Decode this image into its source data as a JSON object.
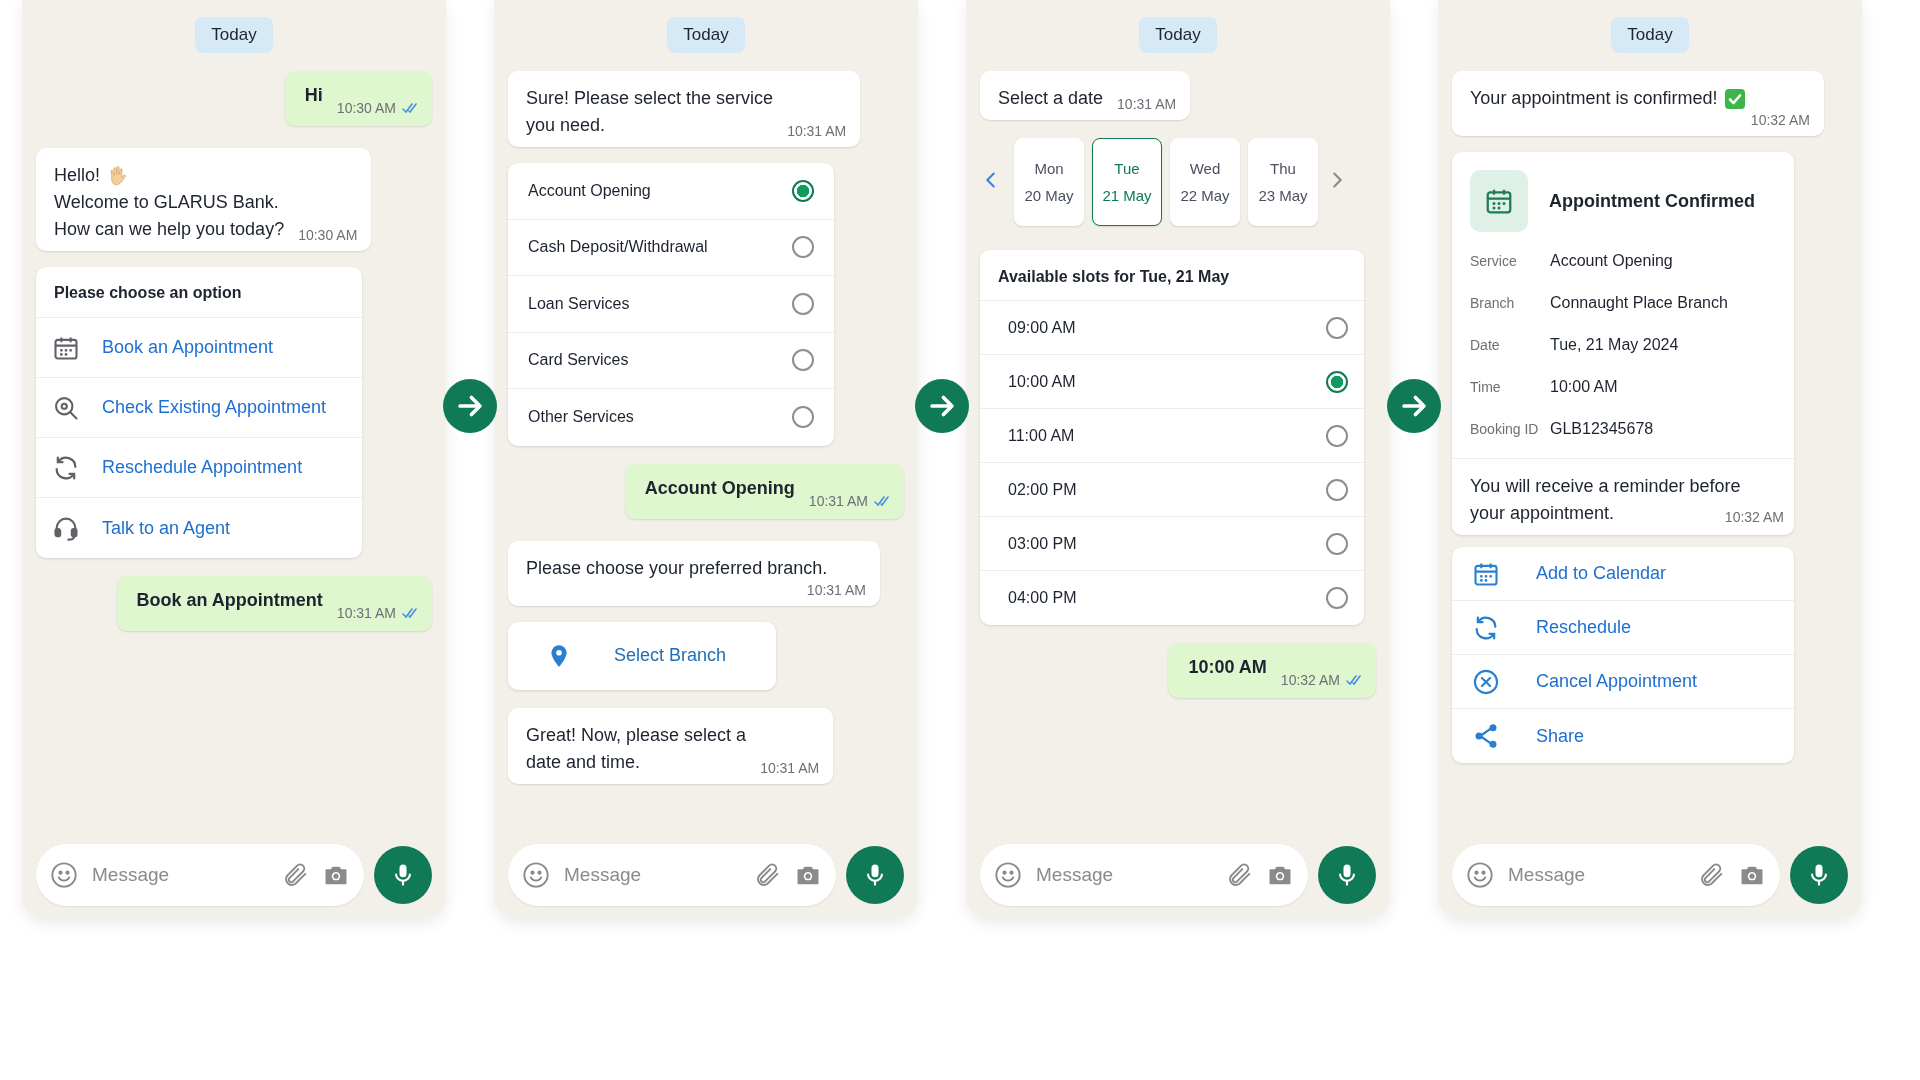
{
  "panels": [
    {
      "date_chip": "Today",
      "messages": [
        {
          "kind": "outgoing",
          "text": "Hi",
          "time": "10:30 AM",
          "read": true
        },
        {
          "kind": "greeting",
          "lines": [
            "Hello!",
            "Welcome to GLARUS Bank.",
            "How can we help you today?"
          ],
          "time": "10:30 AM"
        },
        {
          "kind": "menu",
          "title": "Please choose an option",
          "items": [
            {
              "label": "Book an Appointment"
            },
            {
              "label": "Check Existing Appointment"
            },
            {
              "label": "Reschedule Appointment"
            },
            {
              "label": "Talk to an Agent"
            }
          ]
        },
        {
          "kind": "outgoing",
          "text": "Book an Appointment",
          "time": "10:31 AM",
          "read": true
        }
      ],
      "composer": {
        "placeholder": "Message"
      }
    },
    {
      "date_chip": "Today",
      "messages": [
        {
          "kind": "incoming",
          "lines": [
            "Sure! Please select the service",
            "you need."
          ],
          "time": "10:31 AM"
        },
        {
          "kind": "radio_list",
          "items": [
            {
              "label": "Account Opening",
              "selected": true
            },
            {
              "label": "Cash Deposit/Withdrawal",
              "selected": false
            },
            {
              "label": "Loan Services",
              "selected": false
            },
            {
              "label": "Card Services",
              "selected": false
            },
            {
              "label": "Other Services",
              "selected": false
            }
          ]
        },
        {
          "kind": "outgoing",
          "text": "Account Opening",
          "time": "10:31 AM",
          "read": true
        },
        {
          "kind": "incoming",
          "lines": [
            "Please choose your preferred branch."
          ],
          "time": "10:31 AM"
        },
        {
          "kind": "button",
          "label": "Select Branch"
        },
        {
          "kind": "incoming",
          "lines": [
            "Great! Now, please select a",
            "date and time."
          ],
          "time": "10:31 AM"
        }
      ],
      "composer": {
        "placeholder": "Message"
      }
    },
    {
      "date_chip": "Today",
      "messages": [
        {
          "kind": "incoming",
          "lines": [
            "Select a date"
          ],
          "time": "10:31 AM"
        },
        {
          "kind": "date_picker",
          "days": [
            {
              "day": "Mon",
              "date": "20 May",
              "selected": false
            },
            {
              "day": "Tue",
              "date": "21 May",
              "selected": true
            },
            {
              "day": "Wed",
              "date": "22 May",
              "selected": false
            },
            {
              "day": "Thu",
              "date": "23 May",
              "selected": false
            }
          ]
        },
        {
          "kind": "slots",
          "title": "Available slots for Tue, 21 May",
          "items": [
            {
              "label": "09:00 AM",
              "selected": false
            },
            {
              "label": "10:00 AM",
              "selected": true
            },
            {
              "label": "11:00 AM",
              "selected": false
            },
            {
              "label": "02:00 PM",
              "selected": false
            },
            {
              "label": "03:00 PM",
              "selected": false
            },
            {
              "label": "04:00 PM",
              "selected": false
            }
          ]
        },
        {
          "kind": "outgoing",
          "text": "10:00 AM",
          "time": "10:32 AM",
          "read": true
        }
      ],
      "composer": {
        "placeholder": "Message"
      }
    },
    {
      "date_chip": "Today",
      "messages": [
        {
          "kind": "confirmed_notice",
          "lines": [
            "Your appointment is confirmed!"
          ],
          "time": "10:32 AM"
        },
        {
          "kind": "confirmation",
          "title": "Appointment Confirmed",
          "fields": [
            {
              "label": "Service",
              "value": "Account Opening"
            },
            {
              "label": "Branch",
              "value": "Connaught Place Branch"
            },
            {
              "label": "Date",
              "value": "Tue, 21 May 2024"
            },
            {
              "label": "Time",
              "value": "10:00 AM"
            },
            {
              "label": "Booking ID",
              "value": "GLB12345678"
            }
          ],
          "note": [
            "You will receive a reminder before",
            "your appointment."
          ],
          "time": "10:32 AM"
        },
        {
          "kind": "actions",
          "items": [
            {
              "label": "Add to Calendar"
            },
            {
              "label": "Reschedule"
            },
            {
              "label": "Cancel Appointment"
            },
            {
              "label": "Share"
            }
          ]
        }
      ],
      "composer": {
        "placeholder": "Message"
      }
    }
  ]
}
